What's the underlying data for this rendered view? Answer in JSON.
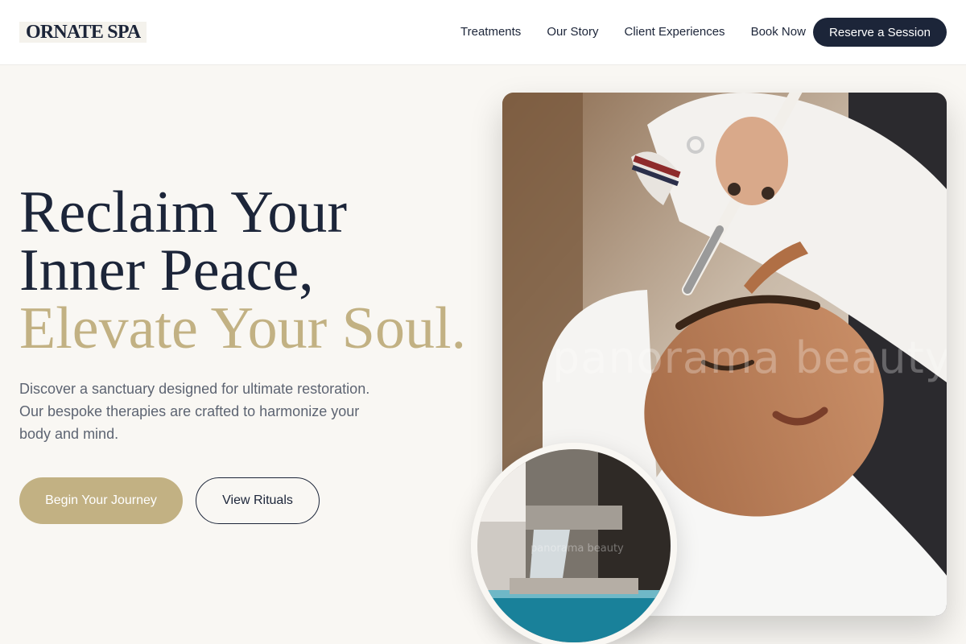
{
  "header": {
    "logo": "ORNATE SPA",
    "nav": [
      "Treatments",
      "Our Story",
      "Client Experiences",
      "Book Now"
    ],
    "cta": "Reserve a Session"
  },
  "hero": {
    "headline_line1": "Reclaim Your",
    "headline_line2": "Inner Peace,",
    "headline_line3": "Elevate Your Soul.",
    "subtext": "Discover a sanctuary designed for ultimate restoration. Our bespoke therapies are crafted to harmonize your body and mind.",
    "primary_button": "Begin Your Journey",
    "secondary_button": "View Rituals"
  },
  "images": {
    "main_watermark": "panorama beauty",
    "inset_watermark": "panorama beauty"
  },
  "colors": {
    "navy": "#1c2539",
    "gold": "#c2b183",
    "background": "#f9f7f3"
  }
}
